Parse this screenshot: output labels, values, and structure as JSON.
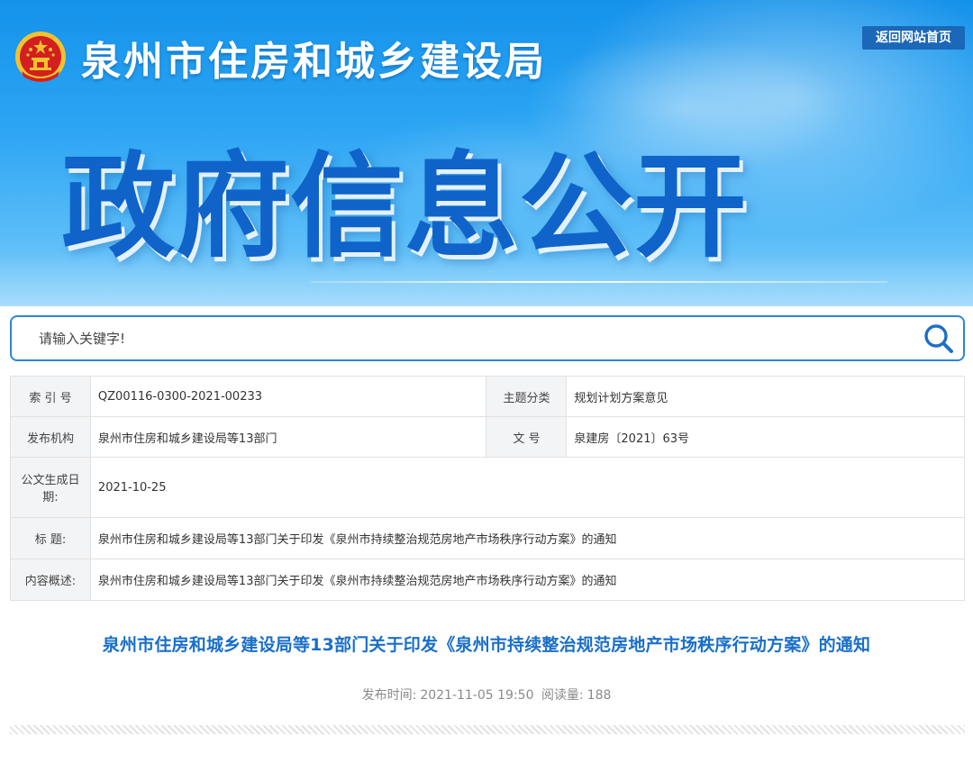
{
  "header": {
    "site_title": "泉州市住房和城乡建设局",
    "back_home_label": "返回网站首页",
    "banner_heading": "政府信息公开"
  },
  "search": {
    "placeholder": "请输入关键字!",
    "icon": "search-icon"
  },
  "info": {
    "index_label": "索 引 号",
    "index_value": "QZ00116-0300-2021-00233",
    "category_label": "主题分类",
    "category_value": "规划计划方案意见",
    "agency_label": "发布机构",
    "agency_value": "泉州市住房和城乡建设局等13部门",
    "docno_label": "文 号",
    "docno_value": "泉建房〔2021〕63号",
    "date_label": "公文生成日期:",
    "date_value": "2021-10-25",
    "title_label": "标 题:",
    "title_value": "泉州市住房和城乡建设局等13部门关于印发《泉州市持续整治规范房地产市场秩序行动方案》的通知",
    "summary_label": "内容概述:",
    "summary_value": "泉州市住房和城乡建设局等13部门关于印发《泉州市持续整治规范房地产市场秩序行动方案》的通知"
  },
  "article": {
    "title": "泉州市住房和城乡建设局等13部门关于印发《泉州市持续整治规范房地产市场秩序行动方案》的通知",
    "publish_label": "发布时间:",
    "publish_time": "2021-11-05 19:50",
    "views_label": "阅读量:",
    "views": "188"
  },
  "colors": {
    "banner_blue": "#1592ea",
    "heading_blue": "#0f63c9",
    "title_blue": "#1a6fc9",
    "search_border": "#2c86d8",
    "button_bg": "#1b67b8",
    "emblem_red": "#d21f1f",
    "emblem_gold": "#f2c230"
  }
}
